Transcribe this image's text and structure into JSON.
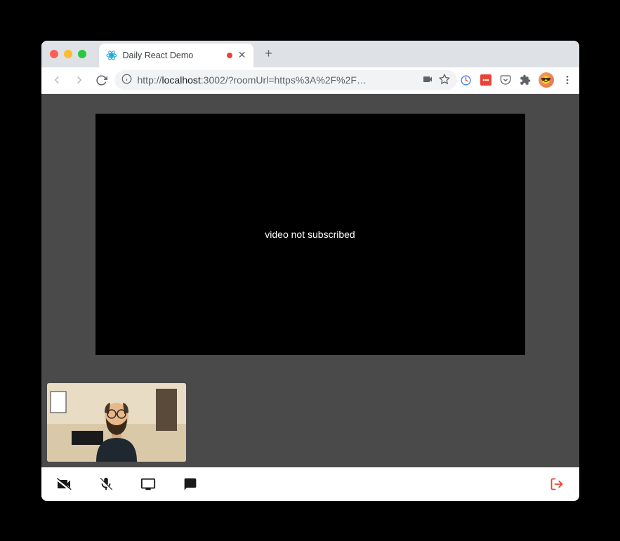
{
  "browser": {
    "tab": {
      "title": "Daily React Demo"
    },
    "url_proto": "http://",
    "url_host": "localhost",
    "url_rest": ":3002/?roomUrl=https%3A%2F%2F…"
  },
  "content": {
    "main_video_message": "video not subscribed"
  },
  "toolbar": {
    "camera_label": "Toggle camera",
    "mic_label": "Toggle microphone",
    "screen_label": "Share screen",
    "chat_label": "Chat",
    "leave_label": "Leave"
  }
}
